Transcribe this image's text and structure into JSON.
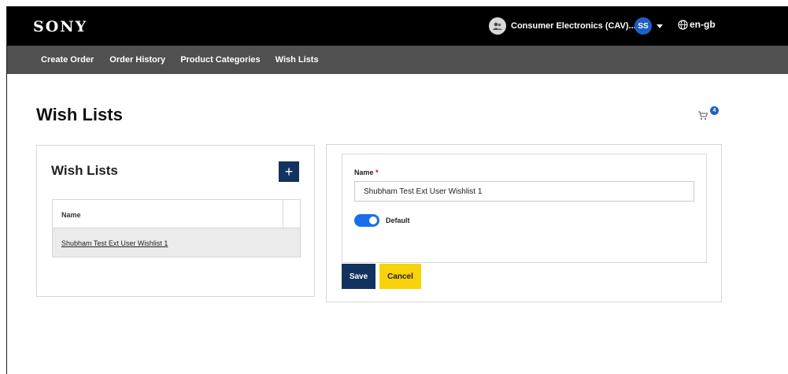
{
  "header": {
    "logo": "SONY",
    "account_label": "Consumer Electronics (CAV)...",
    "user_initials": "SS",
    "language": "en-gb"
  },
  "nav": {
    "items": [
      "Create Order",
      "Order History",
      "Product Categories",
      "Wish Lists"
    ]
  },
  "page": {
    "title": "Wish Lists",
    "cart_count": "4"
  },
  "wishlist_panel": {
    "title": "Wish Lists",
    "add_label": "+",
    "column_name": "Name",
    "rows": [
      "Shubham Test Ext User Wishlist 1"
    ]
  },
  "edit_form": {
    "name_label": "Name",
    "required_mark": "*",
    "name_value": "Shubham Test Ext User Wishlist 1",
    "default_label": "Default",
    "default_on": true,
    "save_label": "Save",
    "cancel_label": "Cancel"
  },
  "colors": {
    "topbar": "#000000",
    "navbar": "#505050",
    "primary_button": "#12325f",
    "cancel_button": "#f8d20a",
    "toggle": "#1a6fe8",
    "user_avatar": "#1f5fc4"
  }
}
